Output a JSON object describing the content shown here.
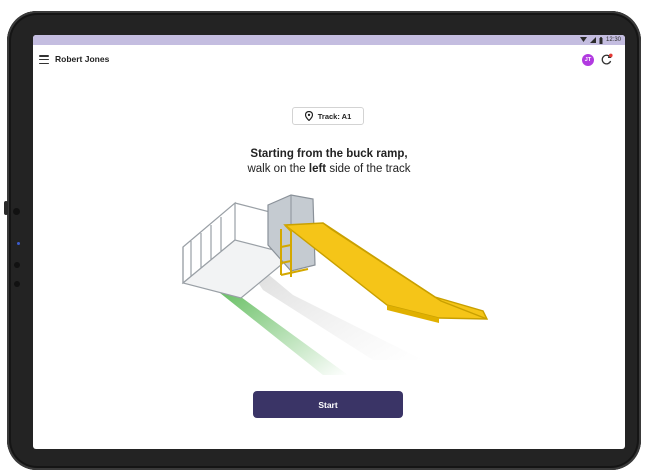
{
  "status_bar": {
    "time": "12:30",
    "icons": [
      "wifi-icon",
      "signal-icon",
      "battery-icon"
    ]
  },
  "app_bar": {
    "menu_icon": "hamburger-menu-icon",
    "user_name": "Robert Jones",
    "avatar_initials": "JT",
    "avatar_color": "#b13ae0",
    "sync_icon": "sync-icon",
    "notification_color": "#e53935"
  },
  "track": {
    "icon": "location-pin-icon",
    "label": "Track: A1"
  },
  "instruction": {
    "line1": "Starting from the buck ramp,",
    "line2_before": "walk on the",
    "line2_bold": "left",
    "line2_after": "side of the track"
  },
  "illustration": {
    "ramp_color": "#f5c518",
    "arrow_color": "#3fae3a"
  },
  "actions": {
    "start_label": "Start",
    "start_color": "#3a3466"
  }
}
